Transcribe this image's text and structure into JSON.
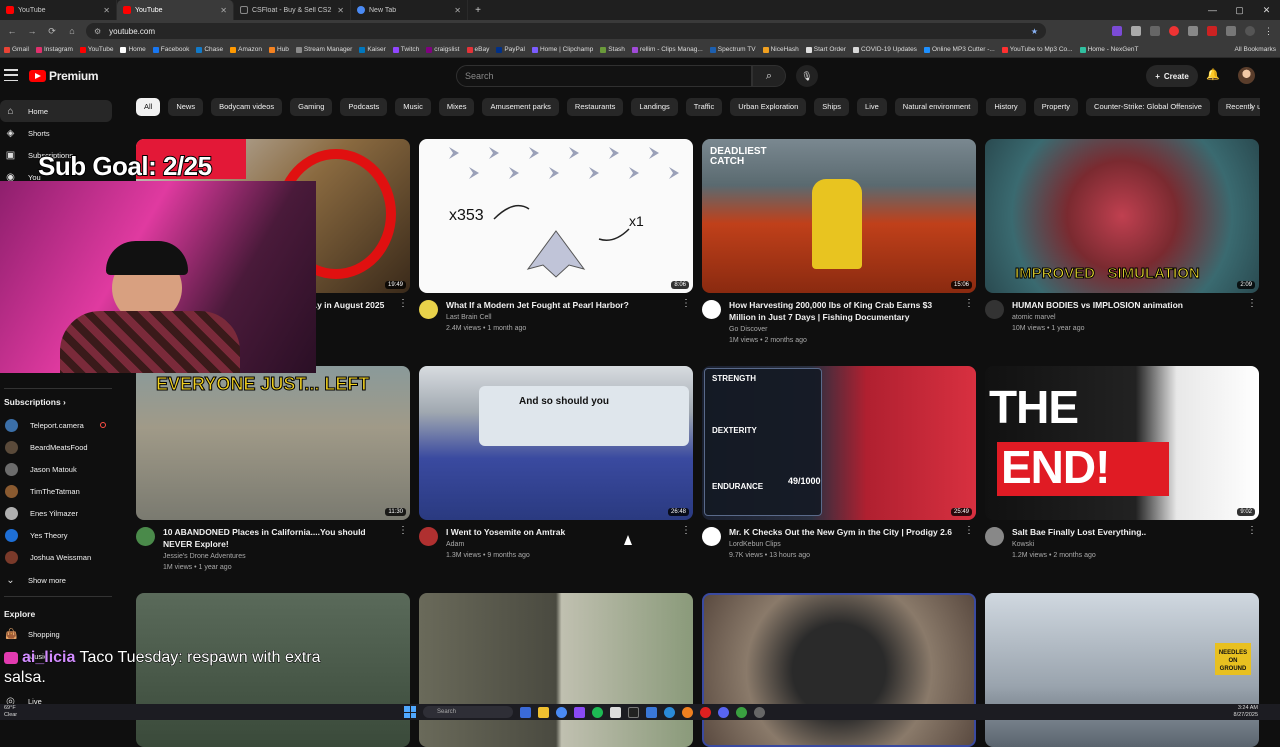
{
  "browser": {
    "tabs": [
      {
        "title": "YouTube",
        "active": false
      },
      {
        "title": "YouTube",
        "active": true
      },
      {
        "title": "CSFloat - Buy & Sell CS2 Skins",
        "active": false
      },
      {
        "title": "New Tab",
        "active": false
      }
    ],
    "url": "youtube.com",
    "bookmarks": [
      "Gmail",
      "Instagram",
      "YouTube",
      "Home",
      "Facebook",
      "Chase",
      "Amazon",
      "Hub",
      "Stream Manager",
      "Kaiser",
      "Twitch",
      "craigslist",
      "eBay",
      "PayPal",
      "Home | Clipchamp",
      "Stash",
      "rellim - Clips Manag...",
      "Spectrum TV",
      "NiceHash",
      "Start Order",
      "COVID-19 Updates",
      "Online MP3 Cutter -...",
      "YouTube to Mp3 Co...",
      "Home - NexGenT"
    ],
    "all_bookmarks": "All Bookmarks"
  },
  "header": {
    "logo_text": "Premium",
    "search_placeholder": "Search",
    "create_label": "Create"
  },
  "chips": [
    "All",
    "News",
    "Bodycam videos",
    "Gaming",
    "Podcasts",
    "Music",
    "Mixes",
    "Amusement parks",
    "Restaurants",
    "Landings",
    "Traffic",
    "Urban Exploration",
    "Ships",
    "Live",
    "Natural environment",
    "History",
    "Property",
    "Counter-Strike: Global Offensive",
    "Recently uploaded",
    "W"
  ],
  "sidebar": {
    "home": "Home",
    "shorts": "Shorts",
    "subscriptions_short": "Subscriptions",
    "you": "You",
    "subscriptions_heading": "Subscriptions",
    "subscriptions": [
      {
        "name": "Teleport.camera",
        "live": true,
        "color": "#3b6fa8"
      },
      {
        "name": "BeardMeatsFood",
        "live": false,
        "color": "#5a4a3a"
      },
      {
        "name": "Jason Matouk",
        "live": false,
        "color": "#6c6c6c"
      },
      {
        "name": "TimTheTatman",
        "live": false,
        "color": "#8a5a30"
      },
      {
        "name": "Enes Yilmazer",
        "live": false,
        "color": "#b0b0b0"
      },
      {
        "name": "Yes Theory",
        "live": false,
        "color": "#1e6fd6"
      },
      {
        "name": "Joshua Weissman",
        "live": false,
        "color": "#7a3a2a"
      }
    ],
    "show_more": "Show more",
    "explore_heading": "Explore",
    "shopping": "Shopping",
    "music": "Music",
    "live": "Live"
  },
  "videos": [
    {
      "title": "...y in August 2025",
      "channel": "",
      "stats": "",
      "duration": "19:49",
      "avatar_color": "#c03030"
    },
    {
      "title": "What If a Modern Jet Fought at Pearl Harbor?",
      "channel": "Last Brain Cell",
      "stats": "2.4M views • 1 month ago",
      "duration": "8:06",
      "avatar_color": "#e8d24a",
      "thumb_x353": "x353",
      "thumb_x1": "x1"
    },
    {
      "title": "How Harvesting 200,000 lbs of King Crab Earns $3 Million in Just 7 Days | Fishing Documentary",
      "channel": "Go Discover",
      "stats": "1M views • 2 months ago",
      "duration": "15:06",
      "avatar_color": "#ffffff",
      "thumb_text": "DEADLIEST CATCH"
    },
    {
      "title": "HUMAN BODIES vs IMPLOSION animation",
      "channel": "atomic marvel",
      "stats": "10M views • 1 year ago",
      "duration": "2:09",
      "avatar_color": "#333333",
      "thumb_text": "IMPROVED   SIMULATION"
    },
    {
      "title": "10 ABANDONED Places in California....You should NEVER Explore!",
      "channel": "Jessie's Drone Adventures",
      "stats": "1M views • 1 year ago",
      "duration": "11:30",
      "avatar_color": "#4a8a4a",
      "thumb_text": "EVERYONE JUST... LEFT"
    },
    {
      "title": "I Went to Yosemite on Amtrak",
      "channel": "Adam",
      "stats": "1.3M views • 9 months ago",
      "duration": "26:48",
      "avatar_color": "#b03030",
      "thumb_text": "And so should you"
    },
    {
      "title": "Mr. K Checks Out the New Gym in the City | Prodigy 2.6",
      "channel": "LordKebun Clips",
      "stats": "9.7K views • 13 hours ago",
      "duration": "25:49",
      "avatar_color": "#ffffff",
      "thumb_strength": "STRENGTH",
      "thumb_dexterity": "DEXTERITY",
      "thumb_endurance": "ENDURANCE",
      "thumb_score": "49/1000"
    },
    {
      "title": "Salt Bae Finally Lost Everything..",
      "channel": "Kowski",
      "stats": "1.2M views • 2 months ago",
      "duration": "9:02",
      "avatar_color": "#888888",
      "thumb_the": "THE",
      "thumb_end": "END!"
    },
    {
      "title": "",
      "channel": "",
      "stats": "",
      "duration": "",
      "avatar_color": "#444"
    },
    {
      "title": "",
      "channel": "",
      "stats": "",
      "duration": "",
      "avatar_color": "#444"
    },
    {
      "title": "",
      "channel": "",
      "stats": "",
      "duration": "",
      "avatar_color": "#444"
    },
    {
      "title": "",
      "channel": "",
      "stats": "",
      "duration": "",
      "avatar_color": "#444",
      "thumb_sign": "NEEDLES ON GROUND"
    }
  ],
  "overlay": {
    "sub_goal": "Sub Goal: 2/25",
    "chat_user": "ai_licia",
    "chat_message": "Taco Tuesday: respawn with extra salsa."
  },
  "taskbar": {
    "temperature": "69°F",
    "condition": "Clear",
    "search_placeholder": "Search",
    "time": "3:24 AM",
    "date": "8/27/2025"
  }
}
